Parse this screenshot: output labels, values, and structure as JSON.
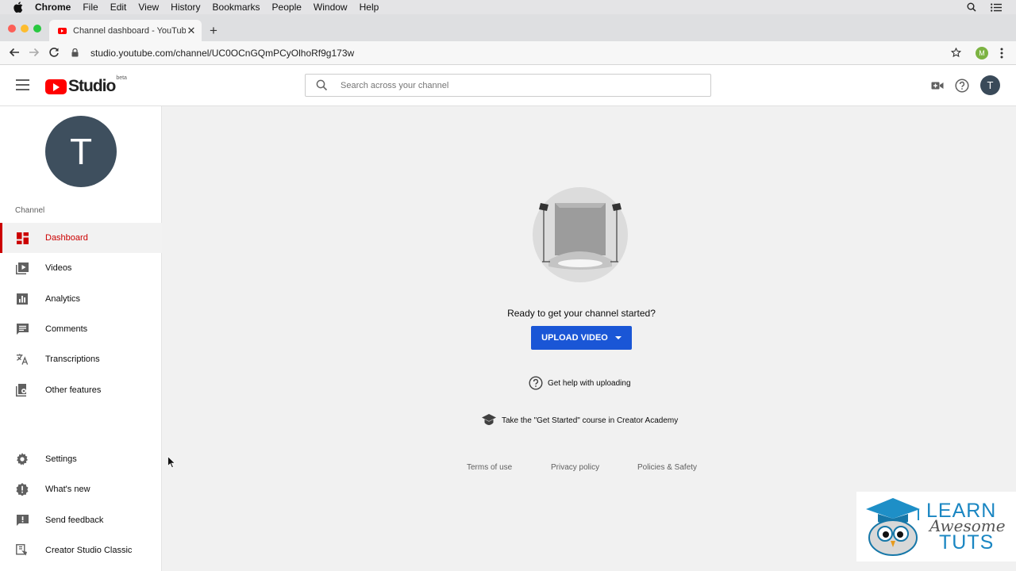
{
  "menubar": {
    "items": [
      "Chrome",
      "File",
      "Edit",
      "View",
      "History",
      "Bookmarks",
      "People",
      "Window",
      "Help"
    ]
  },
  "browser": {
    "tab_title": "Channel dashboard - YouTube Studio",
    "url": "studio.youtube.com/channel/UC0OCnGQmPCyOlhoRf9g173w",
    "profile_initial": "M"
  },
  "header": {
    "logo_text": "Studio",
    "logo_badge": "beta",
    "search_placeholder": "Search across your channel",
    "avatar_initial": "T"
  },
  "sidebar": {
    "avatar_initial": "T",
    "section_label": "Channel",
    "items": [
      {
        "label": "Dashboard",
        "icon": "dashboard-icon",
        "active": true
      },
      {
        "label": "Videos",
        "icon": "videos-icon"
      },
      {
        "label": "Analytics",
        "icon": "analytics-icon"
      },
      {
        "label": "Comments",
        "icon": "comments-icon"
      },
      {
        "label": "Transcriptions",
        "icon": "translate-icon"
      },
      {
        "label": "Other features",
        "icon": "other-features-icon"
      }
    ],
    "bottom_items": [
      {
        "label": "Settings",
        "icon": "gear-icon"
      },
      {
        "label": "What's new",
        "icon": "whats-new-icon"
      },
      {
        "label": "Send feedback",
        "icon": "feedback-icon"
      },
      {
        "label": "Creator Studio Classic",
        "icon": "classic-studio-icon"
      }
    ]
  },
  "main": {
    "ready_text": "Ready to get your channel started?",
    "upload_label": "UPLOAD VIDEO",
    "help_link": "Get help with uploading",
    "course_link": "Take the \"Get Started\" course in Creator Academy",
    "footer": {
      "terms": "Terms of use",
      "privacy": "Privacy policy",
      "policies": "Policies & Safety"
    }
  },
  "watermark": {
    "line1": "LEARN",
    "line2": "Awesome",
    "line3": "TUTS"
  },
  "colors": {
    "accent_red": "#cc0000",
    "upload_blue": "#1a56d6",
    "avatar_slate": "#3e4f5e"
  }
}
